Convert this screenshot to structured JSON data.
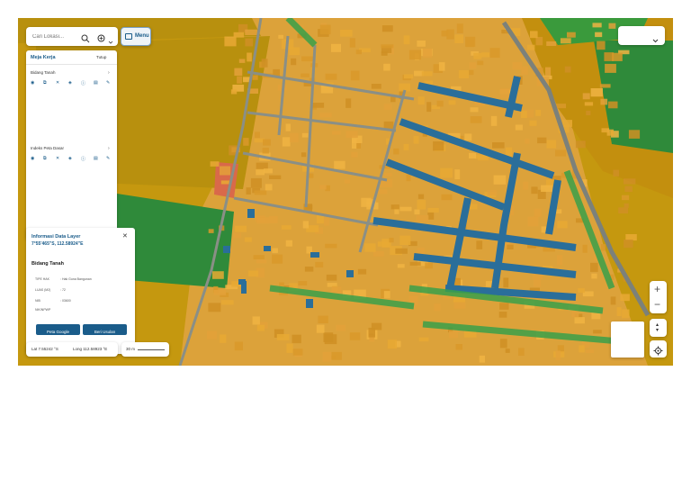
{
  "search": {
    "placeholder": "Cari Lokasi...",
    "icon": "search-icon",
    "zoom_icon": "zoom-in-icon"
  },
  "menu": {
    "label": "Menu",
    "icon": "sidebar-icon"
  },
  "top_right_select": {
    "value": "",
    "icon": "chevron-down-icon"
  },
  "sidebar": {
    "title": "Meja Kerja",
    "close_label": "Tutup",
    "sections": [
      {
        "label": "Bidang Tanah",
        "tools": [
          "eye-icon",
          "layers-icon",
          "close-icon",
          "stack-icon",
          "info-icon",
          "trash-icon",
          "edit-icon"
        ]
      },
      {
        "label": "Indeks Peta Dasar",
        "tools": [
          "eye-icon",
          "layers-icon",
          "close-icon",
          "stack-icon",
          "info-icon",
          "trash-icon",
          "edit-icon"
        ]
      }
    ]
  },
  "info_panel": {
    "title": "Informasi Data Layer",
    "coords": "7°55'465\"S, 112.58924\"E",
    "section": "Bidang Tanah",
    "rows": [
      {
        "key": "TIPE HAK",
        "value": ": Hak Guna Bangunan"
      },
      {
        "key": "LUAS (M2)",
        "value": ": 72"
      },
      {
        "key": "NIB",
        "value": ": 03600"
      },
      {
        "key": "NIK/NPWP",
        "value": ""
      }
    ],
    "button_google": "Peta Google",
    "button_usulan": "Beri Usulan"
  },
  "status": {
    "lat": "Lat 7.55242 °S",
    "lng": "Long 112.58923 °E",
    "scale": "30 m"
  },
  "zoom": {
    "in": "+",
    "out": "−"
  },
  "colors": {
    "parcel": "#e6a52a",
    "road_blue": "#2a6e9a",
    "green": "#3a9a3c",
    "field": "#c5980f",
    "accent": "#1a5c8a"
  }
}
